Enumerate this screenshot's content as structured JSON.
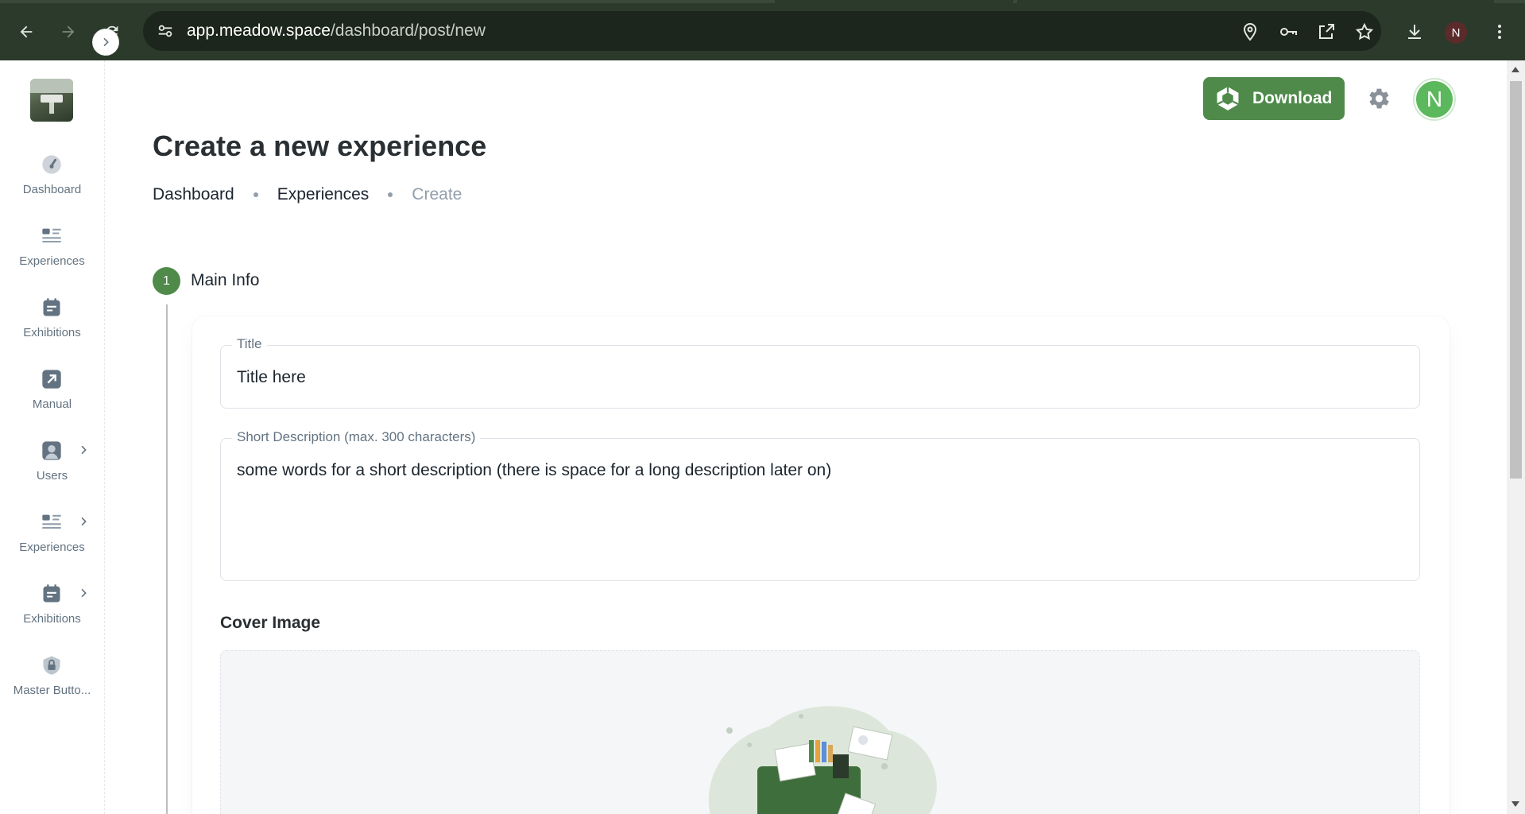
{
  "browser": {
    "url_host": "app.meadow.space",
    "url_path": "/dashboard/post/new",
    "profile_initial": "N",
    "icons": [
      "back-arrow-icon",
      "forward-arrow-icon",
      "reload-icon",
      "site-settings-icon",
      "location-icon",
      "password-key-icon",
      "open-in-app-icon",
      "bookmark-star-icon",
      "downloads-icon",
      "more-vert-icon"
    ]
  },
  "sidebar": {
    "logo_alt": "Meadow logo",
    "items": [
      {
        "label": "Dashboard",
        "icon": "dashboard-gauge-icon",
        "has_children": false
      },
      {
        "label": "Experiences",
        "icon": "list-icon",
        "has_children": false
      },
      {
        "label": "Exhibitions",
        "icon": "calendar-list-icon",
        "has_children": false
      },
      {
        "label": "Manual",
        "icon": "external-link-icon",
        "has_children": false
      },
      {
        "label": "Users",
        "icon": "user-icon",
        "has_children": true
      },
      {
        "label": "Experiences",
        "icon": "list-icon",
        "has_children": true
      },
      {
        "label": "Exhibitions",
        "icon": "calendar-list-icon",
        "has_children": true
      },
      {
        "label": "Master Butto...",
        "icon": "lock-icon",
        "has_children": false
      }
    ]
  },
  "header": {
    "download_label": "Download",
    "avatar_initial": "N"
  },
  "main": {
    "page_title": "Create a new experience",
    "breadcrumb": [
      "Dashboard",
      "Experiences",
      "Create"
    ],
    "step_number": "1",
    "step_label": "Main Info",
    "title_field": {
      "label": "Title",
      "value": "Title here"
    },
    "description_field": {
      "label": "Short Description (max. 300 characters)",
      "value": "some words for a short description (there is space for a long description later on)"
    },
    "cover_image_label": "Cover Image"
  },
  "colors": {
    "primary": "#4f8a4b",
    "browser_frame": "#2b3a2b",
    "avatar": "#5cb85c"
  }
}
